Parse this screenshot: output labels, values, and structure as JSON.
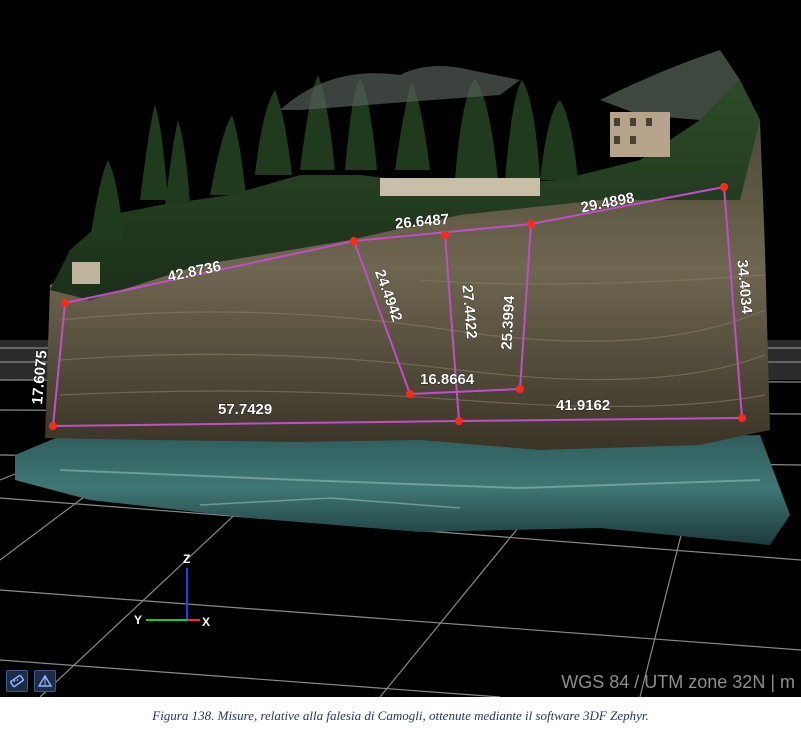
{
  "viewer": {
    "measurements": [
      {
        "id": "top-left-edge",
        "label": "42.8736"
      },
      {
        "id": "top-mid-edge",
        "label": "26.6487"
      },
      {
        "id": "top-right-edge",
        "label": "29.4898"
      },
      {
        "id": "left-vertical",
        "label": "17.6075"
      },
      {
        "id": "inner-diagonal",
        "label": "24.4942"
      },
      {
        "id": "inner-vertical-1",
        "label": "27.4422"
      },
      {
        "id": "inner-vertical-2",
        "label": "25.3994"
      },
      {
        "id": "inner-bottom",
        "label": "16.8664"
      },
      {
        "id": "bottom-left-edge",
        "label": "57.7429"
      },
      {
        "id": "bottom-right-edge",
        "label": "41.9162"
      },
      {
        "id": "right-vertical",
        "label": "34.4034"
      }
    ],
    "axes": {
      "z": "Z",
      "y": "Y",
      "x": "X"
    },
    "toolbar": [
      {
        "id": "tool-1",
        "icon": "measure-tool-icon"
      },
      {
        "id": "tool-2",
        "icon": "mesh-tool-icon"
      }
    ],
    "coordinate_system": "WGS 84 / UTM zone 32N | m",
    "colors": {
      "measure_line": "#c04ec8",
      "measure_point": "#ff2a1a",
      "grid": "#8a8a8a"
    }
  },
  "caption": "Figura 138. Misure, relative alla falesia di Camogli, ottenute mediante il software 3DF Zephyr."
}
